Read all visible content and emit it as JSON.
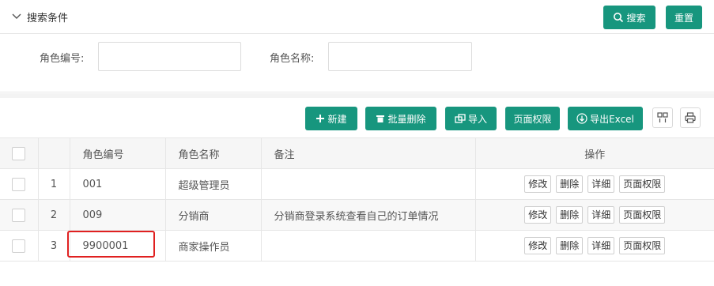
{
  "search": {
    "title": "搜索条件",
    "search_button": "搜索",
    "reset_button": "重置",
    "role_code_label": "角色编号:",
    "role_code_value": "",
    "role_name_label": "角色名称:",
    "role_name_value": ""
  },
  "toolbar": {
    "new_label": "新建",
    "batch_delete_label": "批量删除",
    "import_label": "导入",
    "page_permission_label": "页面权限",
    "export_label": "导出Excel"
  },
  "table": {
    "headers": {
      "code": "角色编号",
      "name": "角色名称",
      "remark": "备注",
      "actions": "操作"
    },
    "rows": [
      {
        "index": "1",
        "code": "001",
        "name": "超级管理员",
        "remark": ""
      },
      {
        "index": "2",
        "code": "009",
        "name": "分销商",
        "remark": "分销商登录系统查看自己的订单情况"
      },
      {
        "index": "3",
        "code": "9900001",
        "name": "商家操作员",
        "remark": ""
      }
    ],
    "row_actions": {
      "edit": "修改",
      "delete": "删除",
      "detail": "详细",
      "page_permission": "页面权限"
    }
  },
  "colors": {
    "primary": "#17967e",
    "highlight": "#e02020"
  }
}
